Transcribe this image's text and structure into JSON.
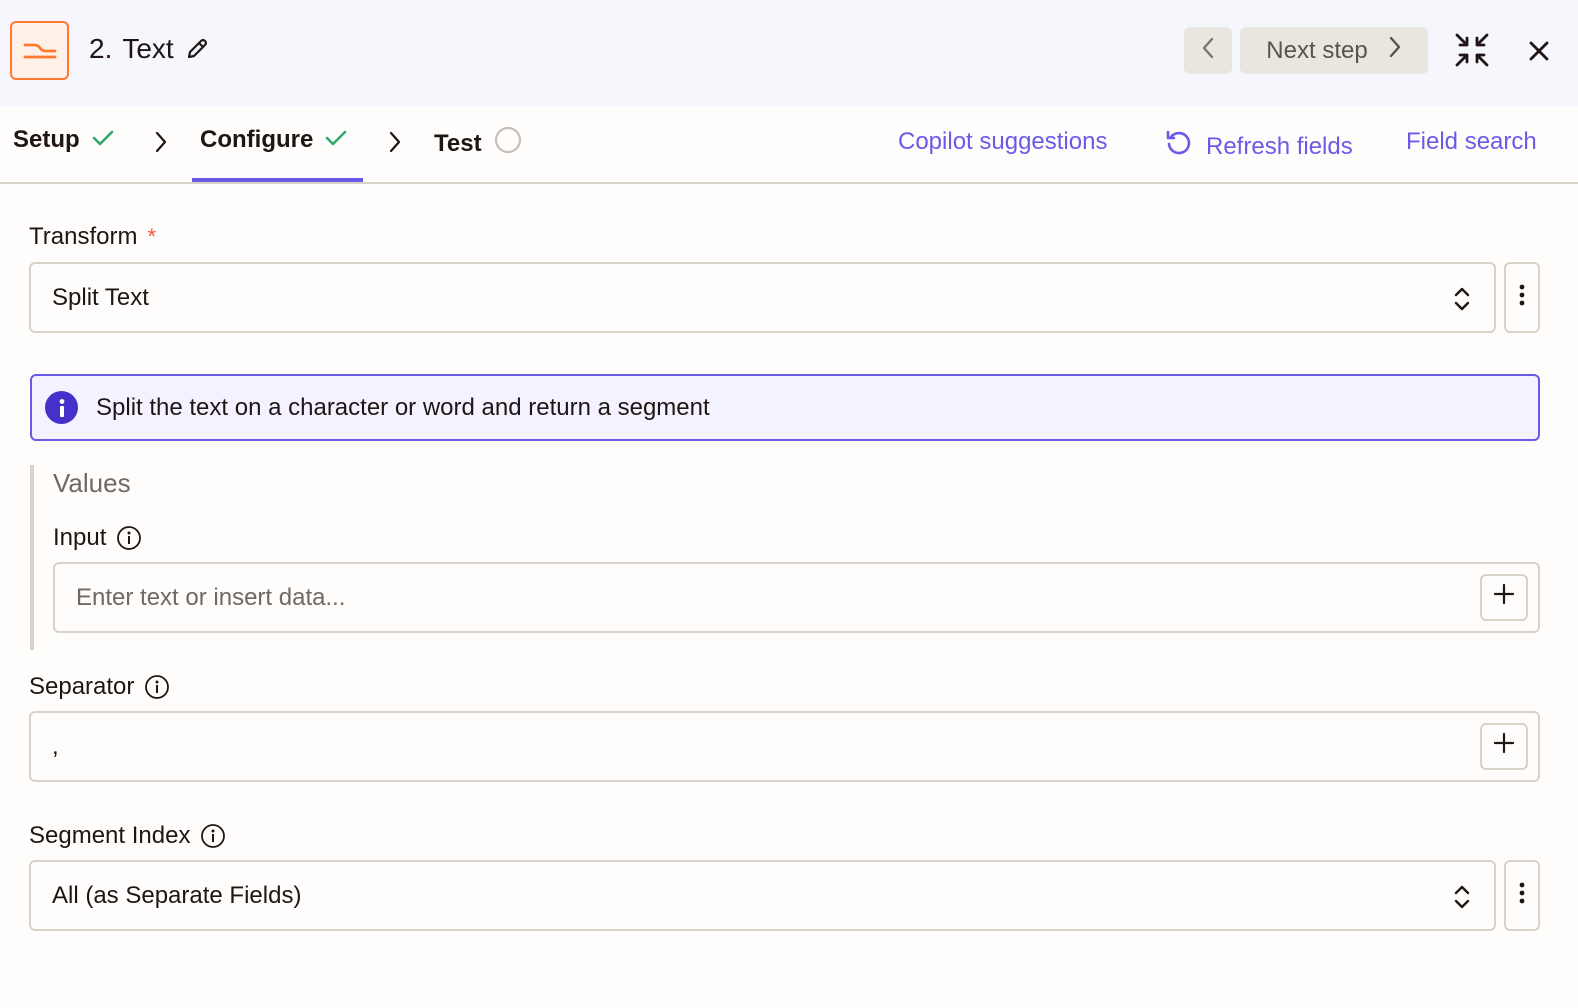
{
  "header": {
    "step_number": "2.",
    "step_name": "Text",
    "next_step_label": "Next step"
  },
  "tabs": {
    "setup": "Setup",
    "configure": "Configure",
    "test": "Test",
    "active": "Configure"
  },
  "actions": {
    "copilot": "Copilot suggestions",
    "refresh": "Refresh fields",
    "search": "Field search"
  },
  "form": {
    "transform": {
      "label": "Transform",
      "required_mark": "*",
      "value": "Split Text"
    },
    "info": "Split the text on a character or word and return a segment",
    "values_group": "Values",
    "input": {
      "label": "Input",
      "placeholder": "Enter text or insert data..."
    },
    "separator": {
      "label": "Separator",
      "value": ","
    },
    "segment_index": {
      "label": "Segment Index",
      "value": "All (as Separate Fields)"
    }
  },
  "colors": {
    "accent": "#695be8",
    "brand_orange": "#ff7a2e",
    "check_green": "#2fa86b",
    "required_red": "#f3523a",
    "header_bg": "#f6f6fd"
  },
  "icons": {
    "app": "text-transform-icon",
    "edit": "pencil-icon",
    "prev": "chevron-left-icon",
    "next": "chevron-right-icon",
    "collapse": "collapse-icon",
    "close": "close-icon",
    "check": "check-icon",
    "pending": "circle-icon",
    "refresh": "refresh-icon",
    "info": "info-icon",
    "more": "kebab-icon",
    "add": "plus-icon",
    "select": "updown-icon"
  }
}
